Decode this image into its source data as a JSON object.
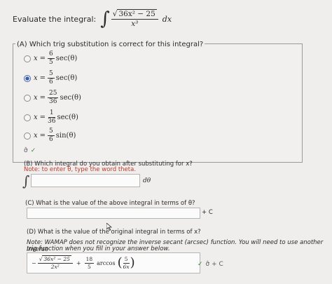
{
  "header": {
    "evaluate_label": "Evaluate the integral:",
    "integral_sign": "∫",
    "integrand_numerator": "36x² − 25",
    "integrand_denominator": "x³",
    "differential": "dx"
  },
  "part_a": {
    "question": "(A) Which trig substitution is correct for this integral?",
    "options": [
      {
        "var": "x",
        "eq": "=",
        "num": "6",
        "den": "5",
        "fn": "sec(θ)",
        "selected": false
      },
      {
        "var": "x",
        "eq": "=",
        "num": "5",
        "den": "6",
        "fn": "sec(θ)",
        "selected": true
      },
      {
        "var": "x",
        "eq": "=",
        "num": "25",
        "den": "36",
        "fn": "sec(θ)",
        "selected": false
      },
      {
        "var": "x",
        "eq": "=",
        "num": "1",
        "den": "36",
        "fn": "sec(θ)",
        "selected": false
      },
      {
        "var": "x",
        "eq": "=",
        "num": "5",
        "den": "6",
        "fn": "sin(θ)",
        "selected": false
      }
    ],
    "check_icon": "check-mark-icon"
  },
  "part_b": {
    "question": "(B) Which integral do you obtain after substituting for x?",
    "note": "Note: to enter θ, type the word theta.",
    "integral_sign": "∫",
    "input_value": "",
    "suffix": "dθ"
  },
  "part_c": {
    "question": "(C) What is the value of the above integral in terms of θ?",
    "input_value": "",
    "suffix": "+ C"
  },
  "part_d": {
    "question": "(D) What is the value of the original integral in terms of x?",
    "note_line1": "Note: WAMAP does not recognize the inverse secant (arcsec) function. You will need to use another inverse",
    "note_line2": "trig function when you fill in your answer below.",
    "answer": {
      "t1_sign": "−",
      "t1_num": "36x² − 25",
      "t1_den": "2x²",
      "plus": "+",
      "t2_num": "18",
      "t2_den": "5",
      "fn": "arccos",
      "arg_num": "5",
      "arg_den": "6x"
    },
    "suffix": "+ C"
  },
  "colors": {
    "note_red": "#c0392b",
    "check_green": "#2e8b2e",
    "radio_blue": "#3b5fa8"
  }
}
